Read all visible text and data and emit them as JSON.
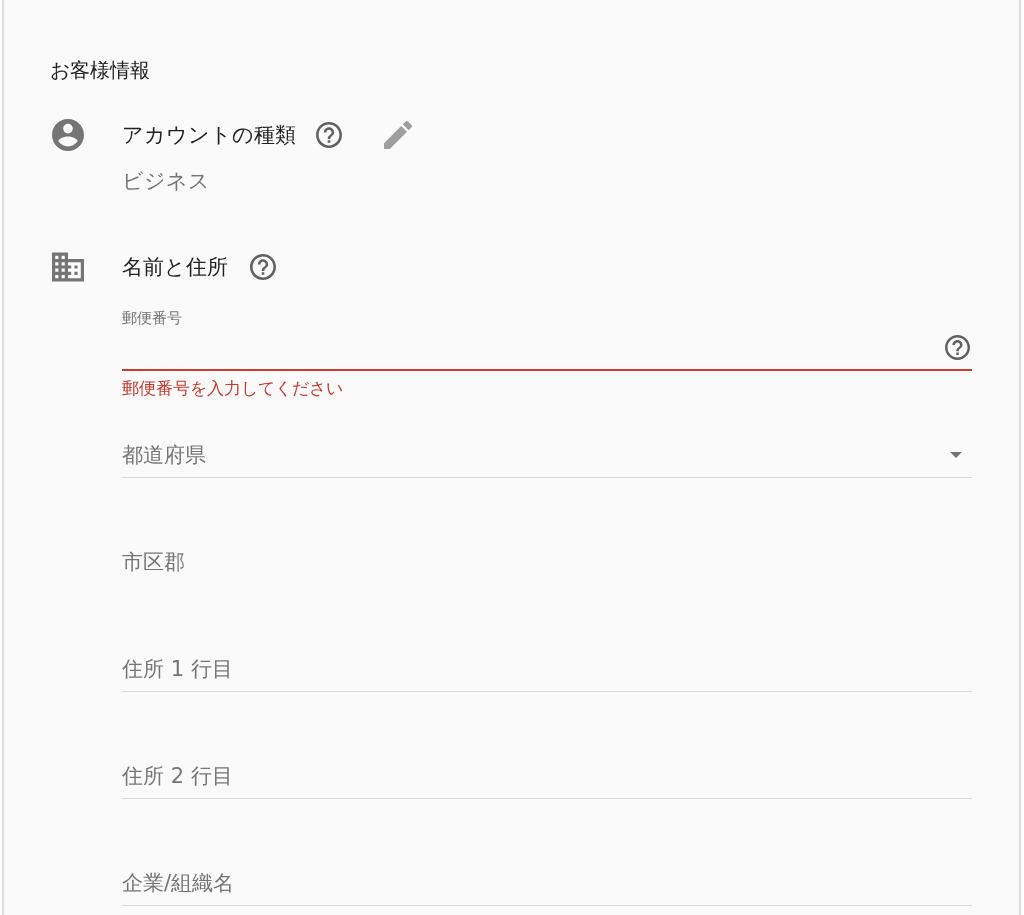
{
  "section": {
    "title": "お客様情報"
  },
  "account_type": {
    "label": "アカウントの種類",
    "value": "ビジネス"
  },
  "name_and_address": {
    "label": "名前と住所",
    "fields": [
      {
        "kind": "text",
        "label": "郵便番号",
        "invalid": true,
        "help": true,
        "error": "郵便番号を入力してください"
      },
      {
        "kind": "dropdown",
        "placeholder": "都道府県",
        "invalid": false,
        "help": false
      },
      {
        "kind": "borderless",
        "placeholder": "市区郡",
        "invalid": false,
        "help": false
      },
      {
        "kind": "text",
        "placeholder": "住所 1 行目",
        "invalid": false,
        "help": false
      },
      {
        "kind": "text",
        "placeholder": "住所 2 行目",
        "invalid": false,
        "help": false
      },
      {
        "kind": "text",
        "placeholder": "企業/組織名",
        "invalid": false,
        "help": false
      }
    ]
  }
}
